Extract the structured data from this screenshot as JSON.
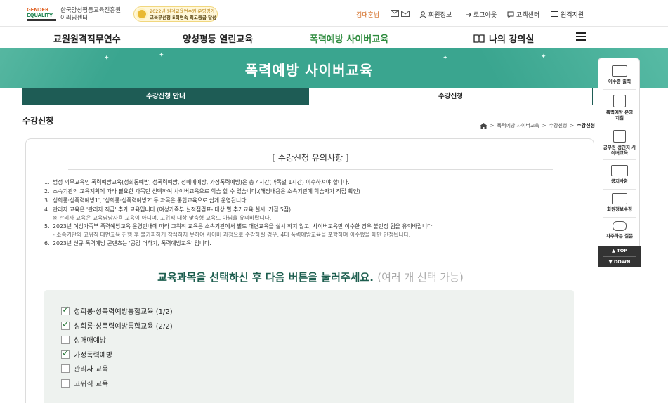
{
  "header": {
    "logo_line1": "GENDER",
    "logo_line2": "EQUALITY",
    "org_name_line1": "한국양성평등교육진흥원",
    "org_name_line2": "이러닝센터",
    "award_line1": "2022년 원격교육연수원 운영평가",
    "award_line2": "교육부선정 5회연속 최고등급 달성",
    "user_name": "김대훈님",
    "util_links": [
      "회원정보",
      "로그아웃",
      "고객센터",
      "원격지원"
    ]
  },
  "nav": {
    "items": [
      "교원원격직무연수",
      "양성평등 열린교육",
      "폭력예방 사이버교육",
      "나의 강의실"
    ],
    "active_index": 2
  },
  "banner": {
    "title": "폭력예방 사이버교육"
  },
  "tabs": [
    {
      "label": "수강신청 안내",
      "active": false
    },
    {
      "label": "수강신청",
      "active": true
    }
  ],
  "page": {
    "title": "수강신청",
    "breadcrumb": [
      "폭력예방 사이버교육",
      "수강신청",
      "수강신청"
    ]
  },
  "notice": {
    "heading": "[ 수강신청 유의사항 ]",
    "rules": [
      {
        "num": "1.",
        "text": "법정 의무교육인 폭력예방교육(성희롱예방, 성폭력예방, 성매매예방, 가정폭력예방)은 총 4시간(과목별 1시간) 이수하셔야 합니다."
      },
      {
        "num": "2.",
        "text": "소속기관의 교육계획에 따라 필요한 과목만 선택하여 사이버교육으로 학습 할 수 있습니다.(해당내용은 소속기관에 학습자가 직접 확인)"
      },
      {
        "num": "3.",
        "text": "성희롱·성폭력예방1', '성희롱·성폭력예방2' 두 과목은 통합교육으로 쉽게 운영됩니다."
      },
      {
        "num": "4.",
        "text": "관리자 교육은 '관리자 직급' 추가 교육입니다.(여성가족부 실적점검표-'대상 별 추가교육 실시' 가점 5점)",
        "sub": "※ 관리자 교육은 교육담당자용 교육이 아니며, 고위직 대상 맞춤형 교육도 아님을 유의바랍니다."
      },
      {
        "num": "5.",
        "text": "2023년 여성가족부 폭력예방교육 운영안내에 따라 고위직 교육은 소속기관에서 별도 대면교육을 실시 하지 않고, 사이버교육만 이수한 경우 불인정 됨을 유의바랍니다.",
        "sub": "- 소속기관의 고위직 대면교육 진행 후 불가피하게 참석하지 못하여 사이버 과정으로 수강하실 경우, 4대 폭력예방교육을 포함하여 이수했을 때만 인정됩니다."
      },
      {
        "num": "6.",
        "text": "2023년 신규 폭력예방 콘텐츠는 '공감 더하기, 폭력예방교육' 입니다."
      }
    ]
  },
  "instruction": {
    "main": "교육과목을 선택하신 후 다음 버튼을 눌러주세요.",
    "sub": "(여러 개 선택 가능)"
  },
  "courses": [
    {
      "label": "성희롱·성폭력예방통합교육 (1/2)",
      "checked": true
    },
    {
      "label": "성희롱·성폭력예방통합교육 (2/2)",
      "checked": true
    },
    {
      "label": "성매매예방",
      "checked": false
    },
    {
      "label": "가정폭력예방",
      "checked": true
    },
    {
      "label": "관리자 교육",
      "checked": false
    },
    {
      "label": "고위직 교육",
      "checked": false
    }
  ],
  "quick_menu": {
    "items": [
      "이수증 출력",
      "폭력예방 운영지침",
      "공무원 성인지 사이버교육",
      "공지사항",
      "회원정보수정",
      "자주하는 질문"
    ],
    "top_label": "▲ TOP",
    "down_label": "▼ DOWN"
  },
  "colors": {
    "brand_green": "#2e8b3e",
    "banner_teal": "#3aa58f",
    "tab_dark": "#1e5c55",
    "instruction_green": "#1d5e4f"
  }
}
